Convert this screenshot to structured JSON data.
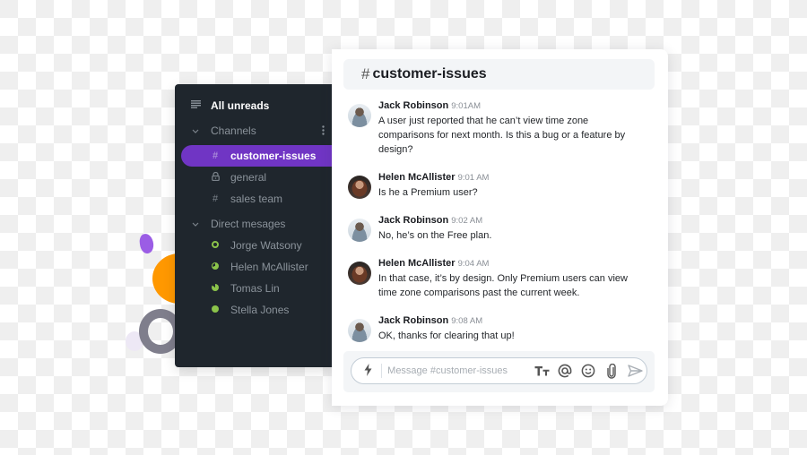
{
  "sidebar": {
    "all_unreads": {
      "label": "All unreads",
      "icon": "list-icon"
    },
    "channels_section": {
      "label": "Channels",
      "icon": "chevron-down-icon",
      "more_icon": "more-vertical-icon"
    },
    "channels": [
      {
        "label": "customer-issues",
        "icon": "hash-icon",
        "glyph": "#",
        "active": true
      },
      {
        "label": "general",
        "icon": "lock-icon",
        "glyph": "🔒",
        "active": false
      },
      {
        "label": "sales team",
        "icon": "hash-icon",
        "glyph": "#",
        "active": false
      }
    ],
    "dm_section": {
      "label": "Direct mesages",
      "icon": "chevron-down-icon"
    },
    "direct_messages": [
      {
        "label": "Jorge Watsony",
        "presence": "online-ring"
      },
      {
        "label": "Helen McAllister",
        "presence": "partial"
      },
      {
        "label": "Tomas Lin",
        "presence": "mostly"
      },
      {
        "label": "Stella Jones",
        "presence": "online"
      }
    ]
  },
  "chat": {
    "channel_hash": "#",
    "channel_name": "customer-issues",
    "messages": [
      {
        "author": "Jack Robinson",
        "time": "9:01AM",
        "avatar": "jack",
        "text": "A user just reported that he can’t view time zone comparisons for next month. Is this a bug or a feature by design?"
      },
      {
        "author": "Helen McAllister",
        "time": "9:01 AM",
        "avatar": "helen",
        "text": "Is he a Premium user?"
      },
      {
        "author": "Jack Robinson",
        "time": "9:02 AM",
        "avatar": "jack",
        "text": "No, he’s on the Free plan."
      },
      {
        "author": "Helen McAllister",
        "time": "9:04 AM",
        "avatar": "helen",
        "text": "In that case, it’s by design. Only Premium users can view time zone comparisons past the current week."
      },
      {
        "author": "Jack Robinson",
        "time": "9:08 AM",
        "avatar": "jack",
        "text": "OK, thanks for clearing that up!"
      }
    ],
    "composer": {
      "placeholder": "Message #customer-issues",
      "value": "",
      "tools": [
        "bolt-icon",
        "text-format-icon",
        "mention-icon",
        "emoji-icon",
        "attachment-icon",
        "send-icon"
      ],
      "format_glyph": "Tᴛ"
    }
  },
  "colors": {
    "sidebar_bg": "#1f262d",
    "accent_purple": "#7035c4",
    "presence_green": "#8bc34a"
  }
}
